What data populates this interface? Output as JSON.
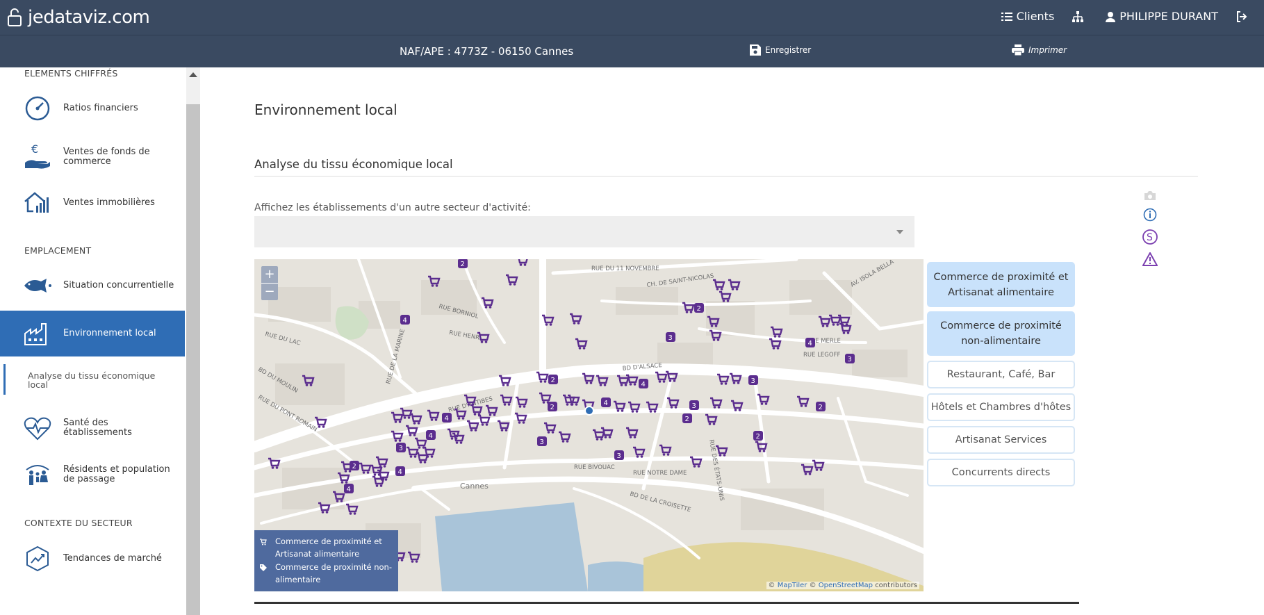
{
  "app": {
    "logo_text": "jedataviz.com"
  },
  "topbar": {
    "clients_label": "Clients",
    "user_name": "PHILIPPE DURANT"
  },
  "subbar": {
    "company_info": "NAF/APE : 4773Z - 06150 Cannes",
    "save_label": "Enregistrer",
    "print_label": "Imprimer"
  },
  "sidebar": {
    "sections": [
      "ELEMENTS CHIFFRÉS",
      "EMPLACEMENT",
      "CONTEXTE DU SECTEUR"
    ],
    "items": [
      {
        "label": "Ratios financiers",
        "icon": "gauge-icon"
      },
      {
        "label": "Ventes de fonds de commerce",
        "icon": "euro-hand-icon"
      },
      {
        "label": "Ventes immobilières",
        "icon": "house-chart-icon"
      },
      {
        "label": "Situation concurrentielle",
        "icon": "fish-icon"
      },
      {
        "label": "Environnement local",
        "icon": "factory-icon",
        "active": true
      },
      {
        "label": "Santé des établissements",
        "icon": "heart-pulse-icon"
      },
      {
        "label": "Résidents et population de passage",
        "icon": "people-icon"
      },
      {
        "label": "Tendances de marché",
        "icon": "trend-hexagon-icon"
      }
    ],
    "sub_item": "Analyse du tissu économique local"
  },
  "main": {
    "title": "Environnement local",
    "section_title": "Analyse du tissu économique local",
    "select_label": "Affichez les établissements d'un autre secteur d'activité:",
    "select_value": ""
  },
  "map": {
    "zoom_in": "+",
    "zoom_out": "−",
    "streets": [
      "RUE DU 11 NOVEMBRE",
      "CH. DE SAINT-NICOLAS",
      "AV. ISOLA BELLA",
      "RUE BORNIOL",
      "RUE HENRI",
      "RUE DE LA MARINE",
      "BD D'ALSACE",
      "RUE LEGOFF",
      "RUE MERLE",
      "BD DE LA CROISETTE",
      "RUE D'ANTIBES",
      "RUE BIVOUAC",
      "RUE NOTRE DAME",
      "RUE DES ÉTATS-UNIS",
      "RUE DU LAC",
      "BD DU MOULIN",
      "RUE DU PONT ROMAIN",
      "Cannes"
    ],
    "legend": [
      {
        "label": "Commerce de proximité et Artisanat alimentaire",
        "icon": "cart-icon"
      },
      {
        "label": "Commerce de proximité non-alimentaire",
        "icon": "tag-icon"
      }
    ],
    "attribution": {
      "prefix": "©",
      "maptiler": "MapTiler",
      "sep": "©",
      "osm": "OpenStreetMap",
      "suffix": "contributors"
    },
    "cluster_counts": [
      "2",
      "3",
      "4"
    ]
  },
  "categories": [
    {
      "label": "Commerce de proximité et Artisanat alimentaire",
      "active": true
    },
    {
      "label": "Commerce de proximité non-alimentaire",
      "active": true
    },
    {
      "label": "Restaurant, Café, Bar",
      "active": false
    },
    {
      "label": "Hôtels et Chambres d'hôtes",
      "active": false
    },
    {
      "label": "Artisanat Services",
      "active": false
    },
    {
      "label": "Concurrents directs",
      "active": false
    }
  ],
  "colors": {
    "header": "#3a4a61",
    "accent": "#2f6db5",
    "marker": "#5b2d8e",
    "map_bg": "#e6e3dc",
    "water": "#a9c4d9"
  }
}
